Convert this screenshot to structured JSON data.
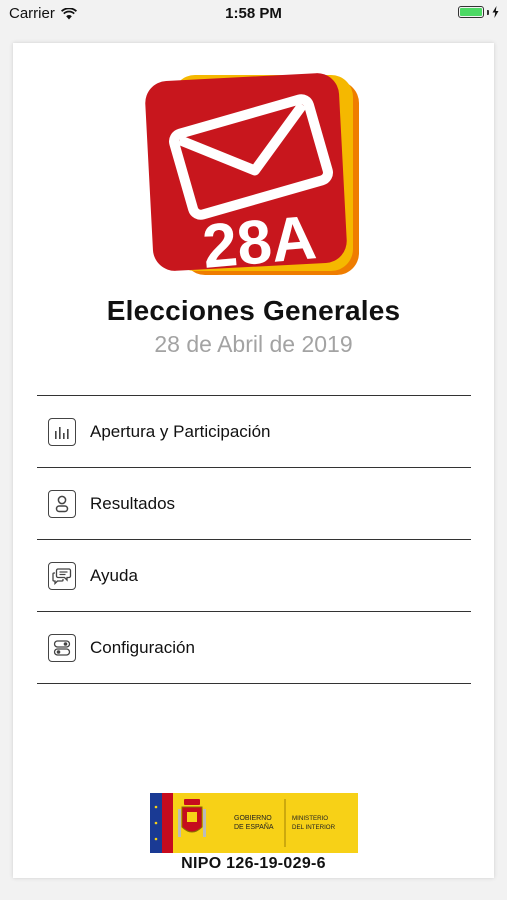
{
  "status_bar": {
    "carrier": "Carrier",
    "time": "1:58 PM",
    "battery_level": 1.0
  },
  "logo": {
    "text": "28A",
    "colors": {
      "red": "#c8161d",
      "yellow": "#f5b800",
      "orange": "#ef7d00"
    }
  },
  "header": {
    "title": "Elecciones Generales",
    "date": "28 de Abril de 2019"
  },
  "menu": {
    "items": [
      {
        "label": "Apertura y Participación",
        "icon": "bar-chart-icon"
      },
      {
        "label": "Resultados",
        "icon": "user-icon"
      },
      {
        "label": "Ayuda",
        "icon": "chat-bubbles-icon"
      },
      {
        "label": "Configuración",
        "icon": "toggles-icon"
      }
    ]
  },
  "footer": {
    "gov_line1": "GOBIERNO",
    "gov_line2": "DE ESPAÑA",
    "ministry_line1": "MINISTERIO",
    "ministry_line2": "DEL INTERIOR",
    "nipo": "NIPO 126-19-029-6"
  }
}
